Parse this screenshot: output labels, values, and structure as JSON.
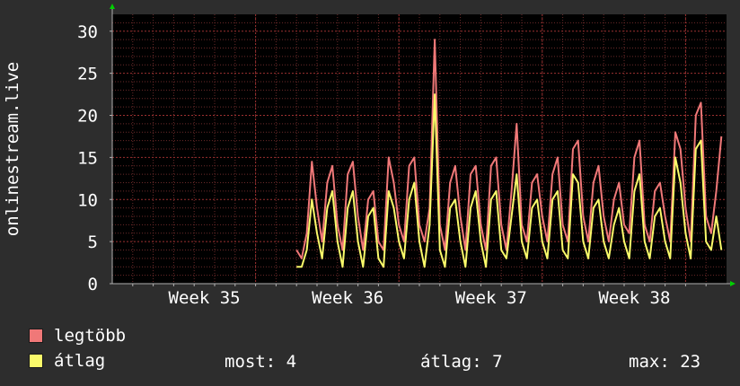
{
  "colors": {
    "background": "#2d2d2d",
    "plot_background": "#000000",
    "grid_minor": "#6b2a2a",
    "grid_major": "#9c3030",
    "axis": "#b0b0b0",
    "max_series": "#f07878",
    "avg_series": "#fafa6a",
    "arrow": "#00d000",
    "text": "#ffffff"
  },
  "legend": {
    "max_label": "legtöbb",
    "avg_label": "átlag"
  },
  "stats": {
    "current": "most: 4",
    "average": "átlag: 7",
    "maximum": "max: 23"
  },
  "chart_data": {
    "type": "line",
    "ylabel": "onlinestream.live",
    "ylim": [
      0,
      32
    ],
    "yticks": [
      "0",
      "5",
      "10",
      "15",
      "20",
      "25",
      "30"
    ],
    "xlim_days": [
      0,
      30
    ],
    "xticks": [
      {
        "label": "Week 35",
        "day": 4.5
      },
      {
        "label": "Week 36",
        "day": 11.5
      },
      {
        "label": "Week 37",
        "day": 18.5
      },
      {
        "label": "Week 38",
        "day": 25.5
      }
    ],
    "grid": true,
    "series": [
      {
        "name": "legtöbb",
        "color": "#f07878",
        "x": [
          9.0,
          9.25,
          9.5,
          9.75,
          10.0,
          10.25,
          10.5,
          10.75,
          11.0,
          11.25,
          11.5,
          11.75,
          12.0,
          12.25,
          12.5,
          12.75,
          13.0,
          13.25,
          13.5,
          13.75,
          14.0,
          14.25,
          14.5,
          14.75,
          15.0,
          15.25,
          15.5,
          15.75,
          16.0,
          16.25,
          16.5,
          16.75,
          17.0,
          17.25,
          17.5,
          17.75,
          18.0,
          18.25,
          18.5,
          18.75,
          19.0,
          19.25,
          19.5,
          19.75,
          20.0,
          20.25,
          20.5,
          20.75,
          21.0,
          21.25,
          21.5,
          21.75,
          22.0,
          22.25,
          22.5,
          22.75,
          23.0,
          23.25,
          23.5,
          23.75,
          24.0,
          24.25,
          24.5,
          24.75,
          25.0,
          25.25,
          25.5,
          25.75,
          26.0,
          26.25,
          26.5,
          26.75,
          27.0,
          27.25,
          27.5,
          27.75,
          28.0,
          28.25,
          28.5,
          28.75,
          29.0,
          29.25,
          29.5,
          29.75
        ],
        "values": [
          4,
          3,
          6,
          14.5,
          9,
          5,
          12,
          14,
          7,
          4,
          13,
          14.5,
          8,
          4,
          10,
          11,
          5,
          4,
          15,
          12,
          7,
          5,
          14,
          15,
          7,
          5,
          9,
          29,
          7,
          4,
          12,
          14,
          8,
          4,
          13,
          14,
          7,
          4,
          14,
          15,
          7,
          4,
          11,
          19,
          7,
          5,
          12,
          13,
          8,
          5,
          13,
          15,
          7,
          5,
          16,
          17,
          8,
          5,
          12,
          14,
          8,
          5,
          10,
          12,
          7,
          6,
          15,
          17,
          7,
          5,
          11,
          12,
          8,
          5,
          18,
          16,
          9,
          5,
          20,
          21.5,
          8,
          6,
          11,
          17.5
        ]
      },
      {
        "name": "átlag",
        "color": "#fafa6a",
        "x": [
          9.0,
          9.25,
          9.5,
          9.75,
          10.0,
          10.25,
          10.5,
          10.75,
          11.0,
          11.25,
          11.5,
          11.75,
          12.0,
          12.25,
          12.5,
          12.75,
          13.0,
          13.25,
          13.5,
          13.75,
          14.0,
          14.25,
          14.5,
          14.75,
          15.0,
          15.25,
          15.5,
          15.75,
          16.0,
          16.25,
          16.5,
          16.75,
          17.0,
          17.25,
          17.5,
          17.75,
          18.0,
          18.25,
          18.5,
          18.75,
          19.0,
          19.25,
          19.5,
          19.75,
          20.0,
          20.25,
          20.5,
          20.75,
          21.0,
          21.25,
          21.5,
          21.75,
          22.0,
          22.25,
          22.5,
          22.75,
          23.0,
          23.25,
          23.5,
          23.75,
          24.0,
          24.25,
          24.5,
          24.75,
          25.0,
          25.25,
          25.5,
          25.75,
          26.0,
          26.25,
          26.5,
          26.75,
          27.0,
          27.25,
          27.5,
          27.75,
          28.0,
          28.25,
          28.5,
          28.75,
          29.0,
          29.25,
          29.5,
          29.75
        ],
        "values": [
          2,
          2,
          4,
          10,
          6,
          3,
          9,
          11,
          5,
          2,
          9,
          11,
          5,
          2,
          8,
          9,
          3,
          2,
          11,
          9,
          5,
          3,
          10,
          12,
          5,
          2,
          7,
          22.5,
          4,
          2,
          9,
          10,
          5,
          2,
          9,
          11,
          5,
          2,
          10,
          11,
          4,
          3,
          8,
          13,
          5,
          3,
          9,
          10,
          5,
          3,
          10,
          11,
          4,
          3,
          13,
          12,
          5,
          3,
          9,
          10,
          5,
          3,
          7,
          9,
          5,
          3,
          11,
          13,
          5,
          3,
          8,
          9,
          5,
          3,
          15,
          12,
          6,
          3,
          16,
          17,
          5,
          4,
          8,
          4
        ]
      }
    ]
  }
}
